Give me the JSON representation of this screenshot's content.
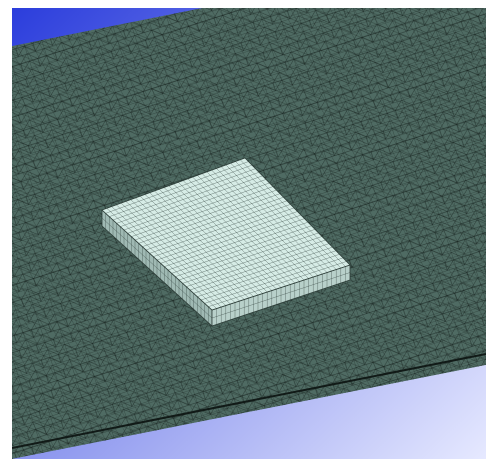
{
  "viewport": {
    "background_top": "#2b3ddc",
    "background_bottom": "#e6e9ff"
  },
  "scene": {
    "base_plate": {
      "fill": "#4f6b63",
      "mesh_line": "#0d1512",
      "mesh_type": "tetrahedral"
    },
    "block": {
      "top_fill": "#d6ece6",
      "front_fill": "#9fb9b3",
      "side_fill": "#b8d0ca",
      "mesh_line": "#2c3c37",
      "mesh_type": "hex"
    }
  }
}
